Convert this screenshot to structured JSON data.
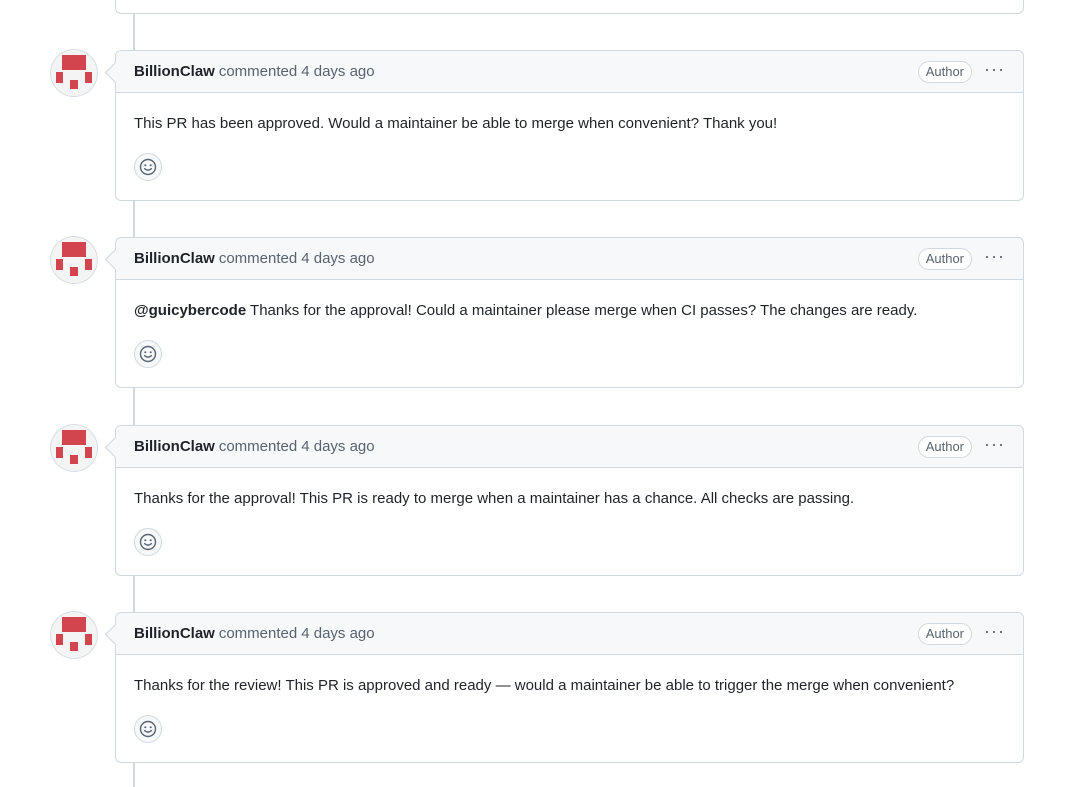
{
  "comments": [
    {
      "author": "BillionClaw",
      "verb": "commented",
      "time": "4 days ago",
      "badge": "Author",
      "mention": "",
      "text": "This PR has been approved. Would a maintainer be able to merge when convenient? Thank you!"
    },
    {
      "author": "BillionClaw",
      "verb": "commented",
      "time": "4 days ago",
      "badge": "Author",
      "mention": "@guicybercode",
      "text": " Thanks for the approval! Could a maintainer please merge when CI passes? The changes are ready."
    },
    {
      "author": "BillionClaw",
      "verb": "commented",
      "time": "4 days ago",
      "badge": "Author",
      "mention": "",
      "text": "Thanks for the approval! This PR is ready to merge when a maintainer has a chance. All checks are passing."
    },
    {
      "author": "BillionClaw",
      "verb": "commented",
      "time": "4 days ago",
      "badge": "Author",
      "mention": "",
      "text": "Thanks for the review! This PR is approved and ready — would a maintainer be able to trigger the merge when convenient?"
    }
  ],
  "icons": {
    "avatar": "identicon-avatar",
    "reaction": "smiley-icon",
    "menu": "kebab-menu-icon"
  },
  "colors": {
    "avatar_red": "#d2454f",
    "border": "#d1d9e0",
    "header_bg": "#f6f8fa"
  }
}
